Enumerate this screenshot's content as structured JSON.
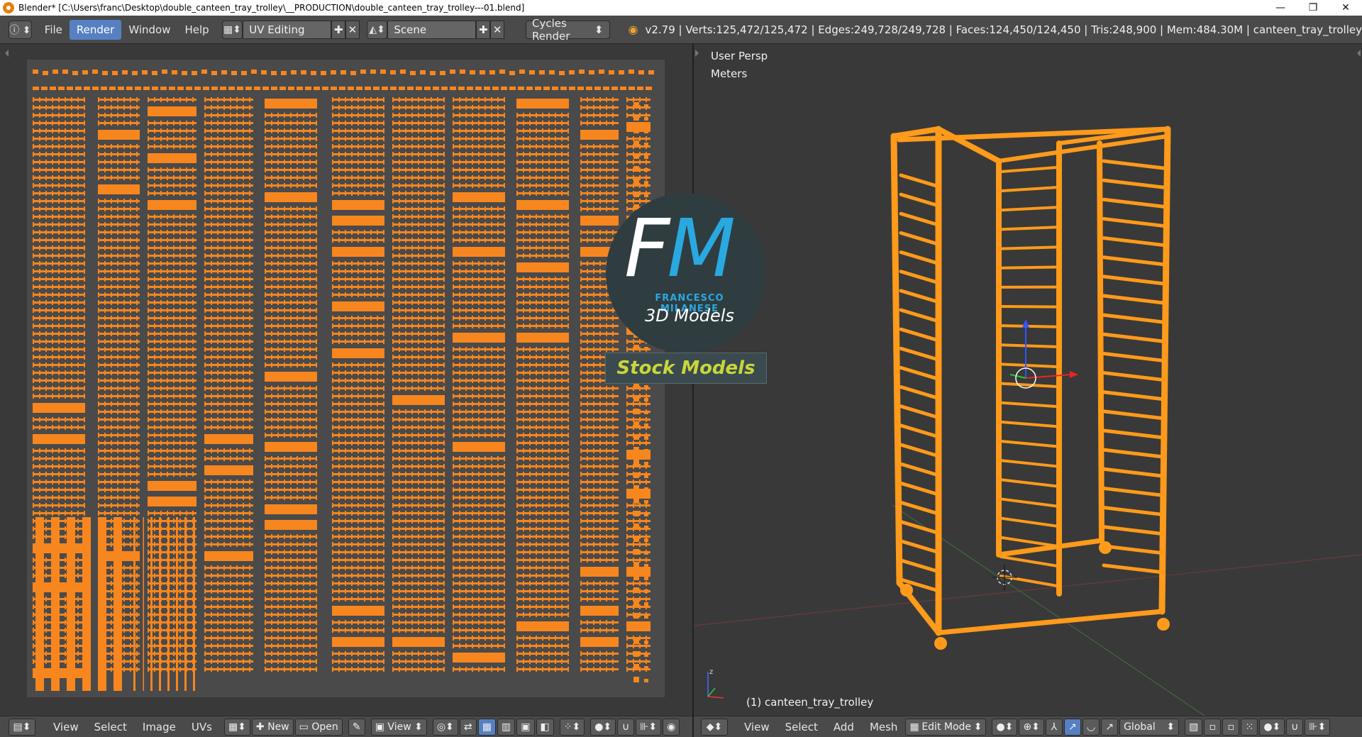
{
  "window": {
    "title": "Blender* [C:\\Users\\franc\\Desktop\\double_canteen_tray_trolley\\__PRODUCTION\\double_canteen_tray_trolley---01.blend]",
    "minimize": "—",
    "maximize": "❐",
    "close": "✕"
  },
  "info_header": {
    "menus": [
      "File",
      "Render",
      "Window",
      "Help"
    ],
    "active_menu": "Render",
    "screen_layout": "UV Editing",
    "scene": "Scene",
    "render_engine": "Cycles Render",
    "stats": "v2.79 | Verts:125,472/125,472 | Edges:249,728/249,728 | Faces:124,450/124,450 | Tris:248,900 | Mem:484.30M | canteen_tray_trolley"
  },
  "viewport": {
    "view_name": "User Persp",
    "units": "Meters",
    "object_label": "(1) canteen_tray_trolley"
  },
  "uv_header": {
    "menus": [
      "View",
      "Select",
      "Image",
      "UVs"
    ],
    "new_label": "New",
    "open_label": "Open",
    "view_label": "View"
  },
  "view3d_header": {
    "menus": [
      "View",
      "Select",
      "Add",
      "Mesh"
    ],
    "mode": "Edit Mode",
    "orientation": "Global"
  },
  "watermark": {
    "logo_f": "F",
    "logo_m": "M",
    "name": "FRANCESCO MILANESE",
    "subtitle": "3D Models",
    "badge": "Stock Models"
  },
  "colors": {
    "uv_island": "#f7861f",
    "active_menu": "#5680c2",
    "mesh": "#ff9a1a"
  }
}
